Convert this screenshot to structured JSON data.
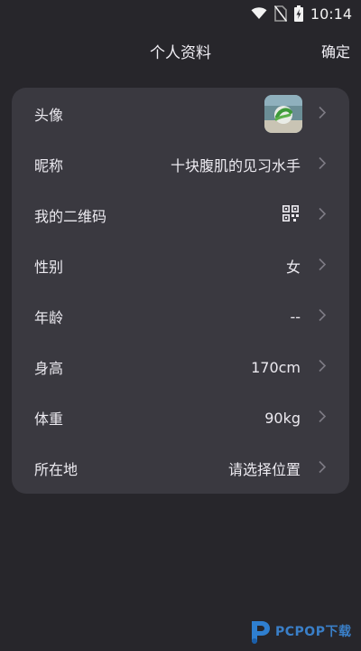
{
  "status_bar": {
    "time": "10:14",
    "icons": [
      "wifi-icon",
      "no-sim-icon",
      "battery-charging-icon"
    ]
  },
  "header": {
    "title": "个人资料",
    "confirm_label": "确定"
  },
  "profile": {
    "avatar": {
      "label": "头像",
      "icon": "avatar-image"
    },
    "nickname": {
      "label": "昵称",
      "value": "十块腹肌的见习水手"
    },
    "qr_code": {
      "label": "我的二维码",
      "icon": "qr-code-icon"
    },
    "gender": {
      "label": "性别",
      "value": "女"
    },
    "age": {
      "label": "年龄",
      "value": "--"
    },
    "height": {
      "label": "身高",
      "value": "170cm"
    },
    "weight": {
      "label": "体重",
      "value": "90kg"
    },
    "location": {
      "label": "所在地",
      "value": "请选择位置"
    }
  },
  "watermark": {
    "text": "PCPOP下载"
  },
  "colors": {
    "background": "#27262b",
    "card": "#3a3940",
    "text": "#eceaf0",
    "chevron": "#7d7b84"
  }
}
